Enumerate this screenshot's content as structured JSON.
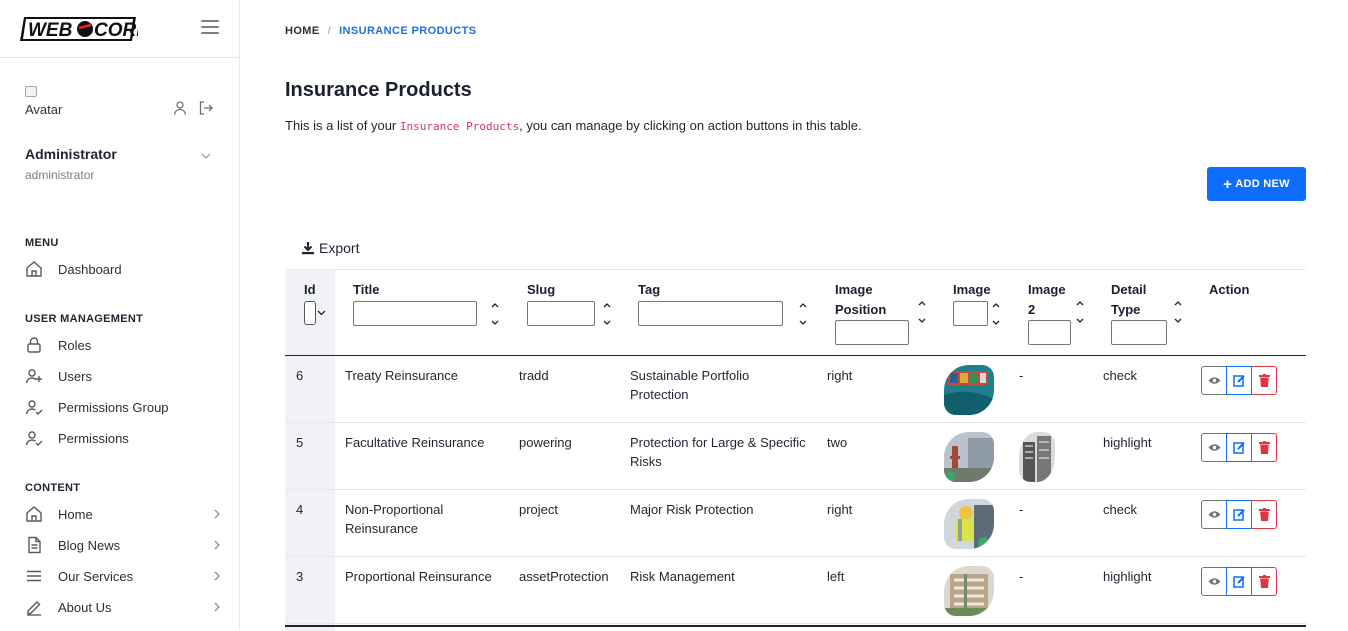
{
  "logo": {
    "text_left": "WEB",
    "text_right": "CORE"
  },
  "user": {
    "avatar_alt": "Avatar",
    "name": "Administrator",
    "role": "administrator"
  },
  "sidebar": {
    "menu_title": "MENU",
    "menu_items": [
      {
        "label": "Dashboard",
        "icon": "home-icon"
      }
    ],
    "user_mgmt_title": "USER MANAGEMENT",
    "user_mgmt_items": [
      {
        "label": "Roles",
        "icon": "lock-icon"
      },
      {
        "label": "Users",
        "icon": "user-plus-icon"
      },
      {
        "label": "Permissions Group",
        "icon": "user-check-icon"
      },
      {
        "label": "Permissions",
        "icon": "user-check-icon"
      }
    ],
    "content_title": "CONTENT",
    "content_items": [
      {
        "label": "Home",
        "icon": "home-icon"
      },
      {
        "label": "Blog News",
        "icon": "document-icon"
      },
      {
        "label": "Our Services",
        "icon": "list-icon"
      },
      {
        "label": "About Us",
        "icon": "pen-icon"
      }
    ]
  },
  "breadcrumb": {
    "home": "HOME",
    "separator": "/",
    "current": "INSURANCE PRODUCTS"
  },
  "page": {
    "title": "Insurance Products",
    "desc_before": "This is a list of your ",
    "desc_code": "Insurance Products",
    "desc_after": ", you can manage by clicking on action buttons in this table.",
    "add_label": "ADD NEW",
    "export_label": "Export"
  },
  "table": {
    "columns": {
      "id": "Id",
      "title": "Title",
      "slug": "Slug",
      "tag": "Tag",
      "image_position_1": "Image",
      "image_position_2": "Position",
      "image": "Image",
      "image2_1": "Image",
      "image2_2": "2",
      "detail_type_1": "Detail",
      "detail_type_2": "Type",
      "action": "Action"
    },
    "rows": [
      {
        "id": "6",
        "title_1": "Treaty Reinsurance",
        "title_2": "",
        "slug": "tradd",
        "tag_1": "Sustainable Portfolio",
        "tag_2": "Protection",
        "image_position": "right",
        "image2": "-",
        "detail_type": "check"
      },
      {
        "id": "5",
        "title_1": "Facultative Reinsurance",
        "title_2": "",
        "slug": "powering",
        "tag_1": "Protection for Large & Specific",
        "tag_2": "Risks",
        "image_position": "two",
        "image2": "",
        "detail_type": "highlight"
      },
      {
        "id": "4",
        "title_1": "Non-Proportional",
        "title_2": "Reinsurance",
        "slug": "project",
        "tag_1": "Major Risk Protection",
        "tag_2": "",
        "image_position": "right",
        "image2": "-",
        "detail_type": "check"
      },
      {
        "id": "3",
        "title_1": "Proportional Reinsurance",
        "title_2": "",
        "slug": "assetProtection",
        "tag_1": "Risk Management",
        "tag_2": "",
        "image_position": "left",
        "image2": "-",
        "detail_type": "highlight"
      }
    ]
  },
  "colors": {
    "primary": "#0d6efd",
    "danger": "#dc3545",
    "secondary": "#6c757d",
    "code": "#d6336c"
  }
}
